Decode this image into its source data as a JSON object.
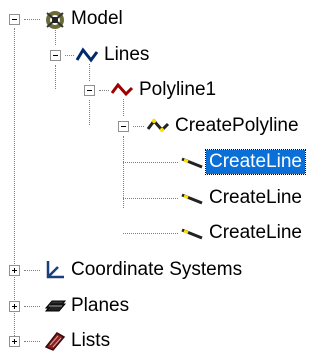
{
  "tree": {
    "model": {
      "label": "Model",
      "icon": "model-icon"
    },
    "lines": {
      "label": "Lines",
      "icon": "lines-icon"
    },
    "polyline1": {
      "label": "Polyline1",
      "icon": "polyline-icon"
    },
    "create_polyline": {
      "label": "CreatePolyline",
      "icon": "create-polyline-icon"
    },
    "create_lines": [
      {
        "label": "CreateLine",
        "icon": "create-line-icon",
        "selected": true
      },
      {
        "label": "CreateLine",
        "icon": "create-line-icon",
        "selected": false
      },
      {
        "label": "CreateLine",
        "icon": "create-line-icon",
        "selected": false
      }
    ],
    "coordinate_systems": {
      "label": "Coordinate Systems",
      "icon": "coordinate-system-icon"
    },
    "planes": {
      "label": "Planes",
      "icon": "planes-icon"
    },
    "lists": {
      "label": "Lists",
      "icon": "lists-icon"
    }
  },
  "colors": {
    "selection": "#0a6fd6",
    "line_yellow": "#ffe000",
    "line_red": "#c00000"
  }
}
